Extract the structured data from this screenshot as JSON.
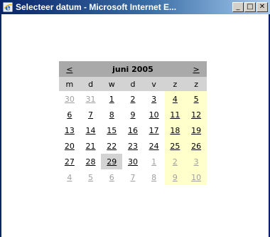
{
  "window": {
    "title": "Selecteer datum - Microsoft Internet E...",
    "minimize_glyph": "_",
    "restore_glyph": "□",
    "close_glyph": "✕",
    "icon": "internet-explorer-icon"
  },
  "calendar": {
    "prev_label": "<",
    "next_label": ">",
    "month_label": "juni 2005",
    "weekday_labels": [
      "m",
      "d",
      "w",
      "d",
      "v",
      "z",
      "z"
    ],
    "weeks": [
      [
        "30",
        "31",
        "1",
        "2",
        "3",
        "4",
        "5"
      ],
      [
        "6",
        "7",
        "8",
        "9",
        "10",
        "11",
        "12"
      ],
      [
        "13",
        "14",
        "15",
        "16",
        "17",
        "18",
        "19"
      ],
      [
        "20",
        "21",
        "22",
        "23",
        "24",
        "25",
        "26"
      ],
      [
        "27",
        "28",
        "29",
        "30",
        "1",
        "2",
        "3"
      ],
      [
        "4",
        "5",
        "6",
        "7",
        "8",
        "9",
        "10"
      ]
    ],
    "today": "29",
    "colors": {
      "header_bg": "#a9a9a9",
      "weekday_bg": "#d3d3d3",
      "weekend_bg": "#ffffcc",
      "today_bg": "#d3d3d3",
      "other_month_text": "#a0a0a0"
    }
  }
}
